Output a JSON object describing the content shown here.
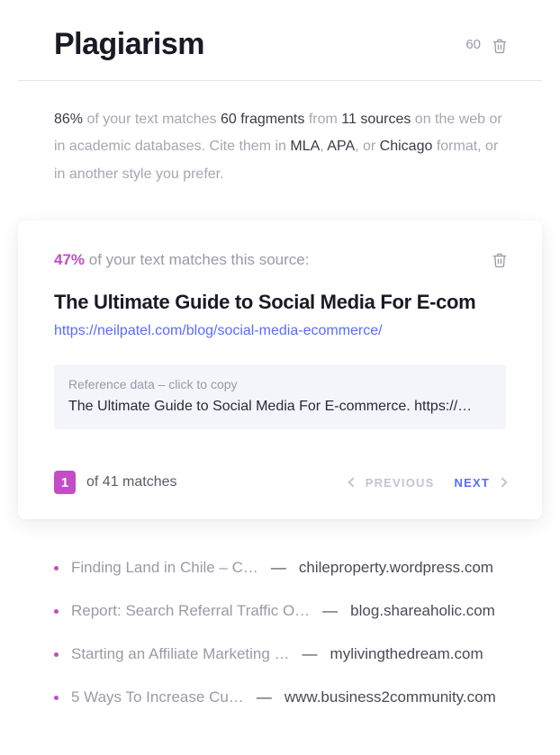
{
  "header": {
    "title": "Plagiarism",
    "count": "60"
  },
  "summary": {
    "percent": "86%",
    "t1": " of your text matches ",
    "fragments": "60 fragments",
    "t2": " from ",
    "sources": "11 sources",
    "t3": " on the web or in academic databases. Cite them in ",
    "fmt1": "MLA",
    "sep1": ", ",
    "fmt2": "APA",
    "sep2": ", or ",
    "fmt3": "Chicago",
    "t4": " format, or in another style you prefer."
  },
  "card": {
    "match_pct": "47%",
    "match_rest": " of your text matches this source:",
    "source_title": "The Ultimate Guide to Social Media For E-com",
    "source_url": "https://neilpatel.com/blog/social-media-ecommerce/",
    "ref_label": "Reference data – click to copy",
    "ref_text": "The Ultimate Guide to Social Media For E-commerce. https://…",
    "nav": {
      "badge": "1",
      "of_text": "of 41 matches",
      "prev": "PREVIOUS",
      "next": "NEXT"
    }
  },
  "list": [
    {
      "title": "Finding Land in Chile – C…",
      "domain": "chileproperty.wordpress.com"
    },
    {
      "title": "Report: Search Referral Traffic O…",
      "domain": "blog.shareaholic.com"
    },
    {
      "title": "Starting an Affiliate Marketing …",
      "domain": "mylivingthedream.com"
    },
    {
      "title": "5 Ways To Increase Cu…",
      "domain": "www.business2community.com"
    }
  ],
  "dash": "—"
}
